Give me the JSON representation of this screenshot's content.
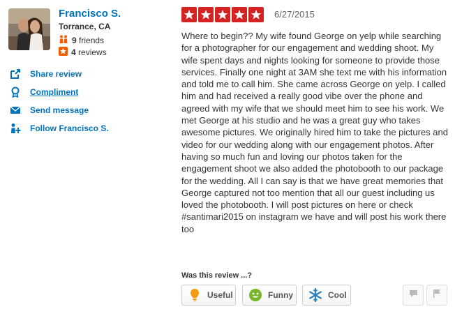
{
  "user": {
    "name": "Francisco S.",
    "location": "Torrance, CA",
    "friends_count": "9",
    "friends_label": "friends",
    "reviews_count": "4",
    "reviews_label": "reviews"
  },
  "actions": [
    {
      "label": "Share review",
      "icon": "share-icon"
    },
    {
      "label": "Compliment",
      "icon": "compliment-icon"
    },
    {
      "label": "Send message",
      "icon": "envelope-icon"
    },
    {
      "label": "Follow Francisco S.",
      "icon": "follow-user-icon"
    }
  ],
  "review": {
    "rating": 5,
    "date": "6/27/2015",
    "text": "Where to begin?? My wife found George on yelp while searching for a photographer for our engagement and wedding shoot.  My wife spent days and nights looking for someone to provide those services.  Finally one night at 3AM she text me with his information and told me to call him.  She came across George on yelp.  I called him and had received a really good vibe over the phone and agreed with my wife that we should meet him to see his work.  We met George at his studio and he was a great guy who takes awesome pictures.  We originally hired him to take the pictures and video for our wedding along with our engagement photos.  After having so much fun and loving our photos taken for the engagement shoot we also added the photobooth to our package for the wedding.  All I can say is that we have great memories that George captured not too mention that all our guest including us loved the photobooth.  I will post pictures on here or check #santimari2015 on instagram we have and will post his work there too"
  },
  "feedback": {
    "question": "Was this review ...?",
    "useful": "Useful",
    "funny": "Funny",
    "cool": "Cool"
  },
  "colors": {
    "brand_red": "#d32323",
    "link_blue": "#0073bb",
    "funny_green": "#7ab62a",
    "cool_blue": "#2b7fc2",
    "useful_orange": "#f39c12"
  }
}
